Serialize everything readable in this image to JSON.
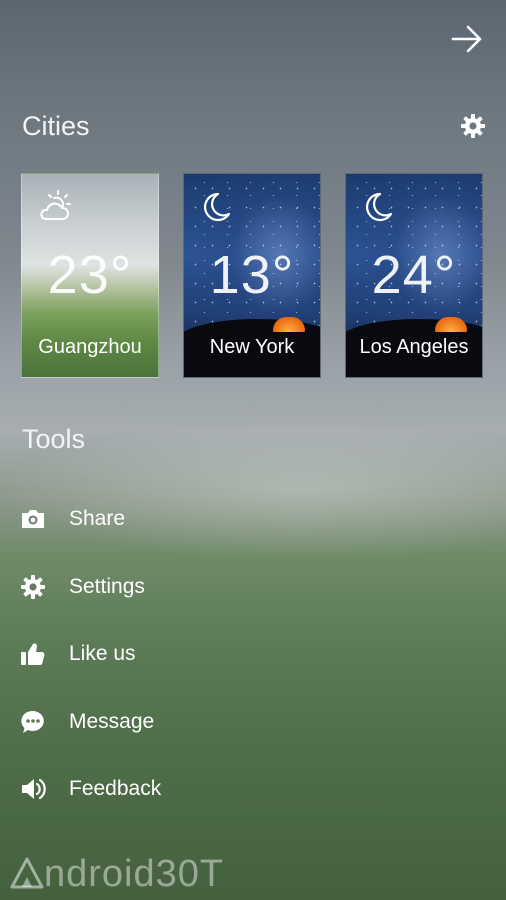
{
  "cities_section": {
    "title": "Cities"
  },
  "cities": [
    {
      "name": "Guangzhou",
      "temperature": "23°",
      "icon": "partly-cloudy-icon"
    },
    {
      "name": "New York",
      "temperature": "13°",
      "icon": "moon-icon"
    },
    {
      "name": "Los Angeles",
      "temperature": "24°",
      "icon": "moon-icon"
    }
  ],
  "tools_section": {
    "title": "Tools",
    "items": [
      {
        "label": "Share",
        "icon": "camera-icon"
      },
      {
        "label": "Settings",
        "icon": "gear-icon"
      },
      {
        "label": "Like us",
        "icon": "thumbs-up-icon"
      },
      {
        "label": "Message",
        "icon": "chat-bubble-icon"
      },
      {
        "label": "Feedback",
        "icon": "speaker-icon"
      }
    ]
  },
  "watermark": {
    "text": "ndroid30T"
  }
}
